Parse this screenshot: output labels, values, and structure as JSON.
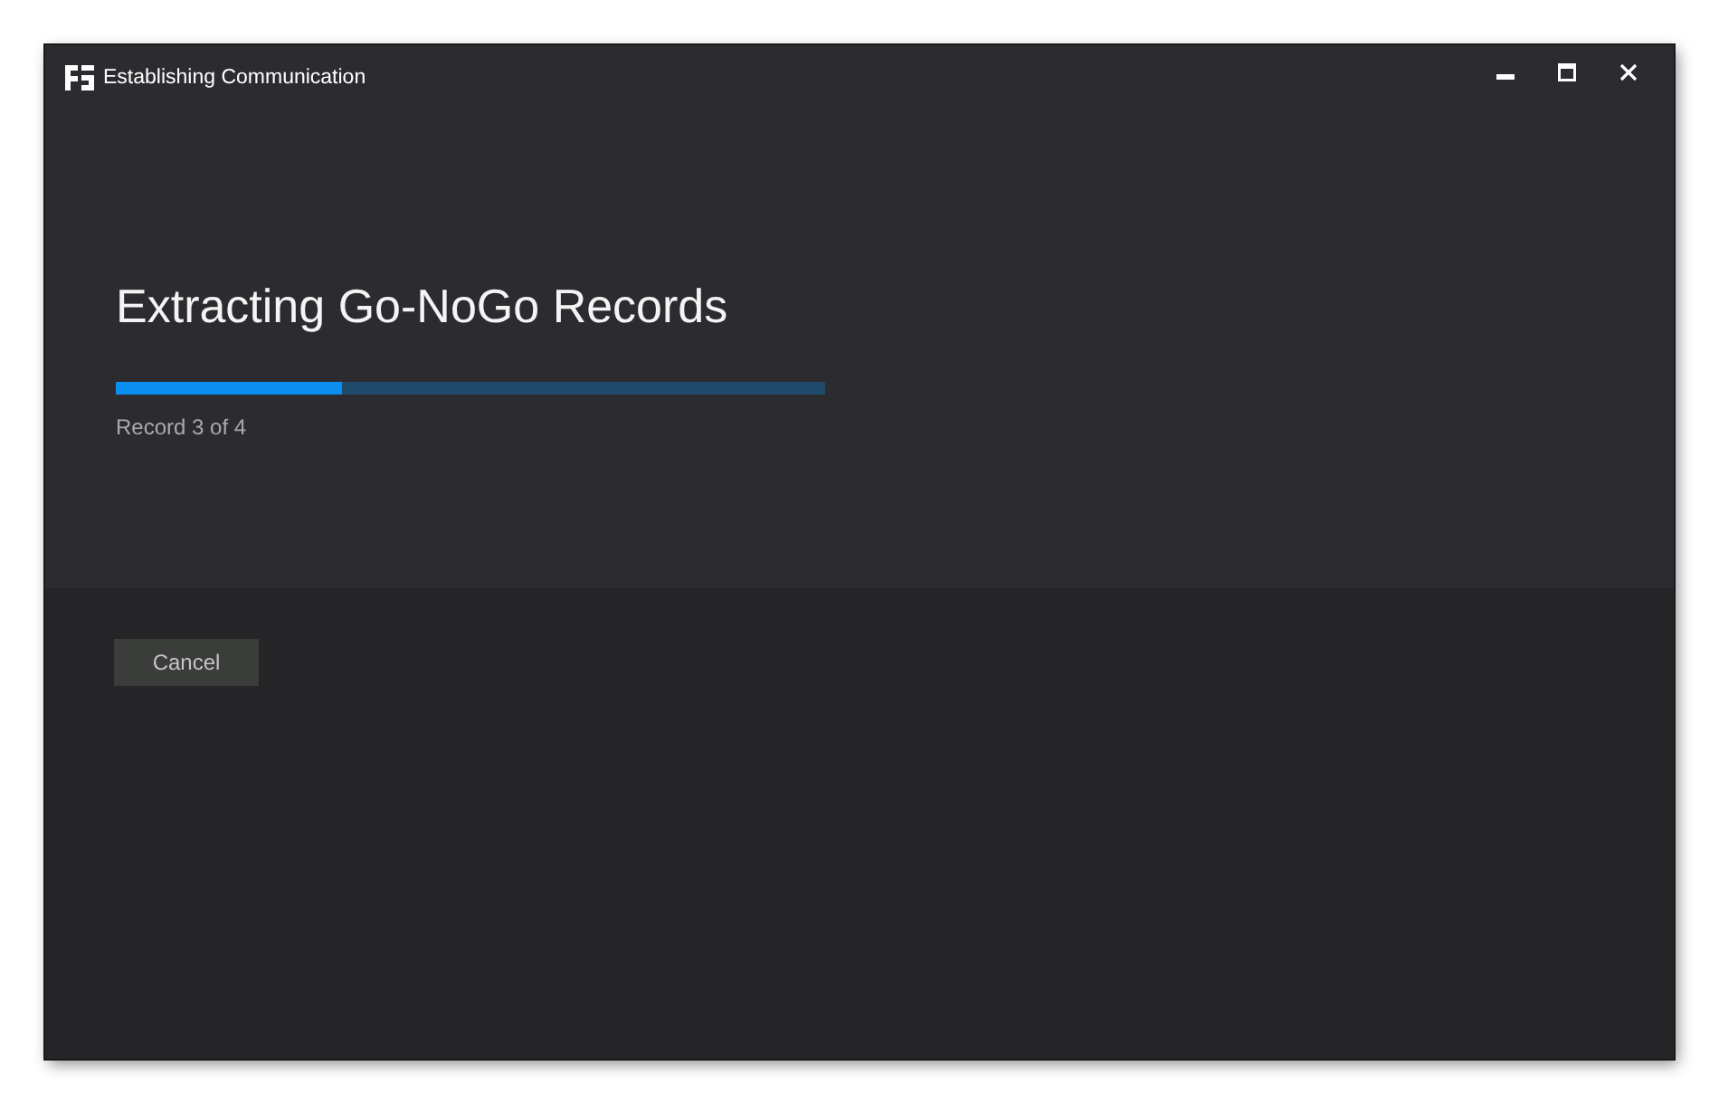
{
  "window": {
    "title": "Establishing Communication"
  },
  "task": {
    "heading": "Extracting Go-NoGo Records",
    "progress": {
      "level": 0.32
    },
    "status": "Record 3 of 4"
  },
  "buttons": [
    {
      "label": "Cancel"
    }
  ]
}
